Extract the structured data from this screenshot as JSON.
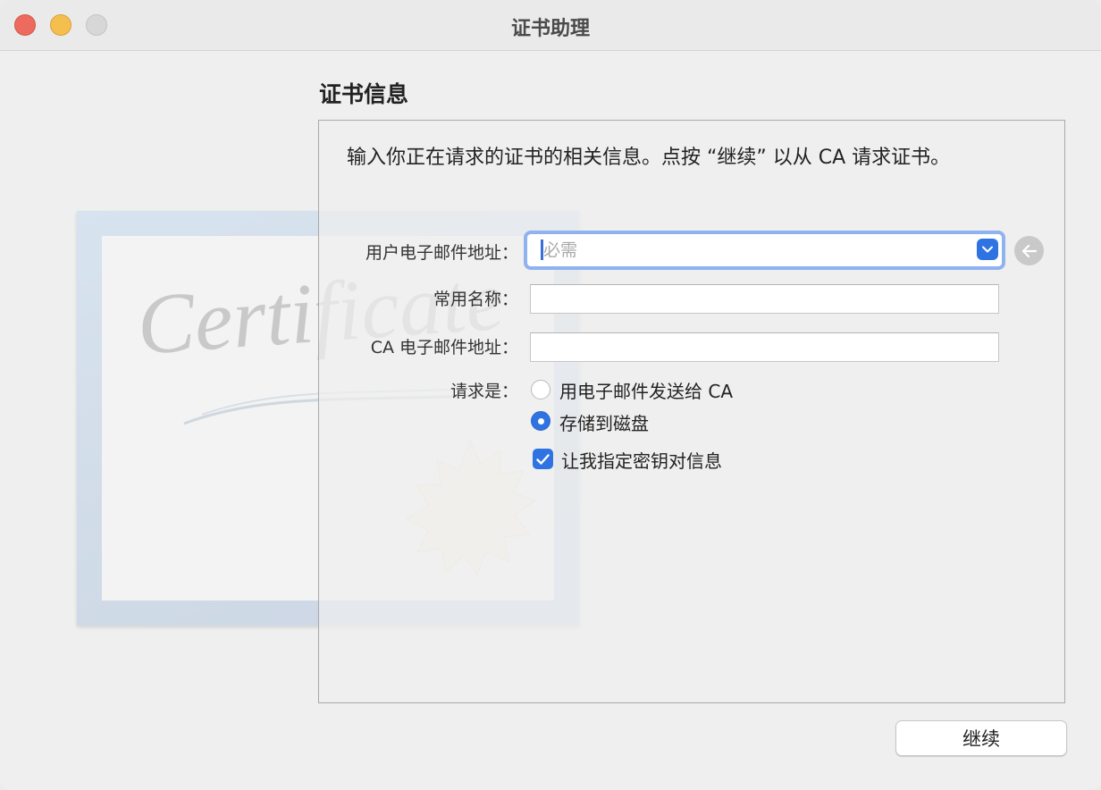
{
  "window": {
    "title": "证书助理"
  },
  "section_title": "证书信息",
  "description": "输入你正在请求的证书的相关信息。点按 “继续” 以从 CA 请求证书。",
  "illustration": {
    "script_text": "Certificate"
  },
  "form": {
    "email_label": "用户电子邮件地址：",
    "email_placeholder": "必需",
    "email_value": "",
    "common_name_label": "常用名称：",
    "common_name_value": "",
    "ca_email_label": "CA 电子邮件地址：",
    "ca_email_value": "",
    "request_label": "请求是：",
    "options": [
      {
        "label": "用电子邮件发送给 CA",
        "selected": false
      },
      {
        "label": "存储到磁盘",
        "selected": true
      }
    ],
    "key_pair_checkbox": {
      "label": "让我指定密钥对信息",
      "checked": true
    }
  },
  "buttons": {
    "continue_label": "继续"
  },
  "colors": {
    "accent": "#2f73e3",
    "focus_ring": "#8fb2f0",
    "close": "#ec6a5e",
    "minimize": "#f4bf4f",
    "maximize_disabled": "#d7d7d7"
  },
  "icons": {
    "combo": "chevron-down-icon",
    "back": "arrow-left-icon",
    "check": "checkmark-icon"
  }
}
